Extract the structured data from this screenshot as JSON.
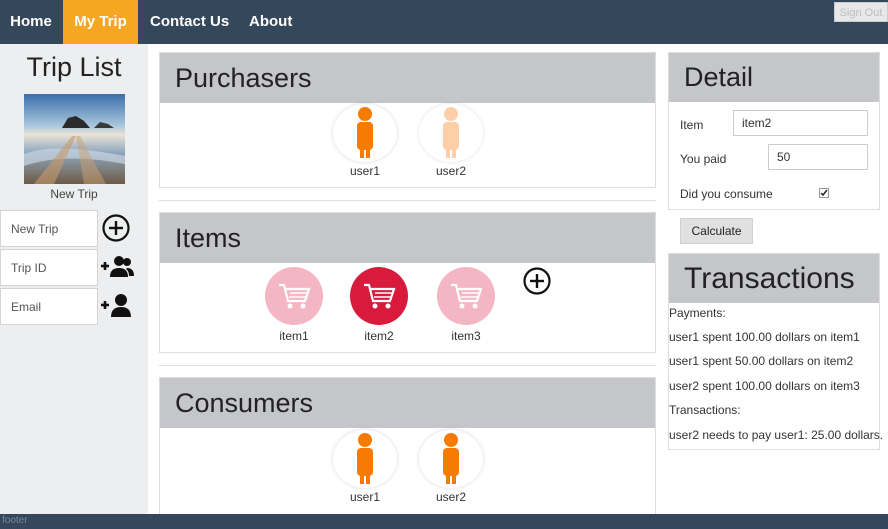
{
  "nav": {
    "items": [
      {
        "label": "Home"
      },
      {
        "label": "My Trip"
      },
      {
        "label": "Contact Us"
      },
      {
        "label": "About"
      }
    ],
    "sign_out_label": "Sign Out"
  },
  "sidebar": {
    "title": "Trip List",
    "trip_caption": "New Trip",
    "fields": [
      {
        "placeholder": "New Trip",
        "icon": "plus-circle-icon"
      },
      {
        "placeholder": "Trip ID",
        "icon": "add-group-icon"
      },
      {
        "placeholder": "Email",
        "icon": "add-user-icon"
      }
    ]
  },
  "purchasers": {
    "title": "Purchasers",
    "users": [
      {
        "label": "user1",
        "state": "selected"
      },
      {
        "label": "user2",
        "state": "faded"
      }
    ]
  },
  "items": {
    "title": "Items",
    "list": [
      {
        "label": "item1",
        "state": "faded"
      },
      {
        "label": "item2",
        "state": "selected"
      },
      {
        "label": "item3",
        "state": "faded"
      }
    ],
    "add_icon": "plus-circle-icon"
  },
  "consumers": {
    "title": "Consumers",
    "users": [
      {
        "label": "user1",
        "state": "selected"
      },
      {
        "label": "user2",
        "state": "selected"
      }
    ]
  },
  "detail": {
    "title": "Detail",
    "item_label": "Item",
    "item_value": "item2",
    "paid_label": "You paid",
    "paid_value": "50",
    "consume_label": "Did you consume",
    "consume_checked": true
  },
  "calculate_label": "Calculate",
  "transactions": {
    "title": "Transactions",
    "lines": [
      "Payments:",
      "user1 spent 100.00 dollars on item1",
      "user1 spent 50.00 dollars on item2",
      "user2 spent 100.00 dollars on item3",
      "Transactions:",
      "user2 needs to pay user1: 25.00 dollars."
    ]
  },
  "footer_text": "footer",
  "colors": {
    "nav_bg": "#35475a",
    "active_tab": "#f5a623",
    "user_orange": "#f57c00",
    "user_faded": "#fccfa9",
    "item_selected": "#d81b3c",
    "item_faded": "#f4b6c2"
  }
}
